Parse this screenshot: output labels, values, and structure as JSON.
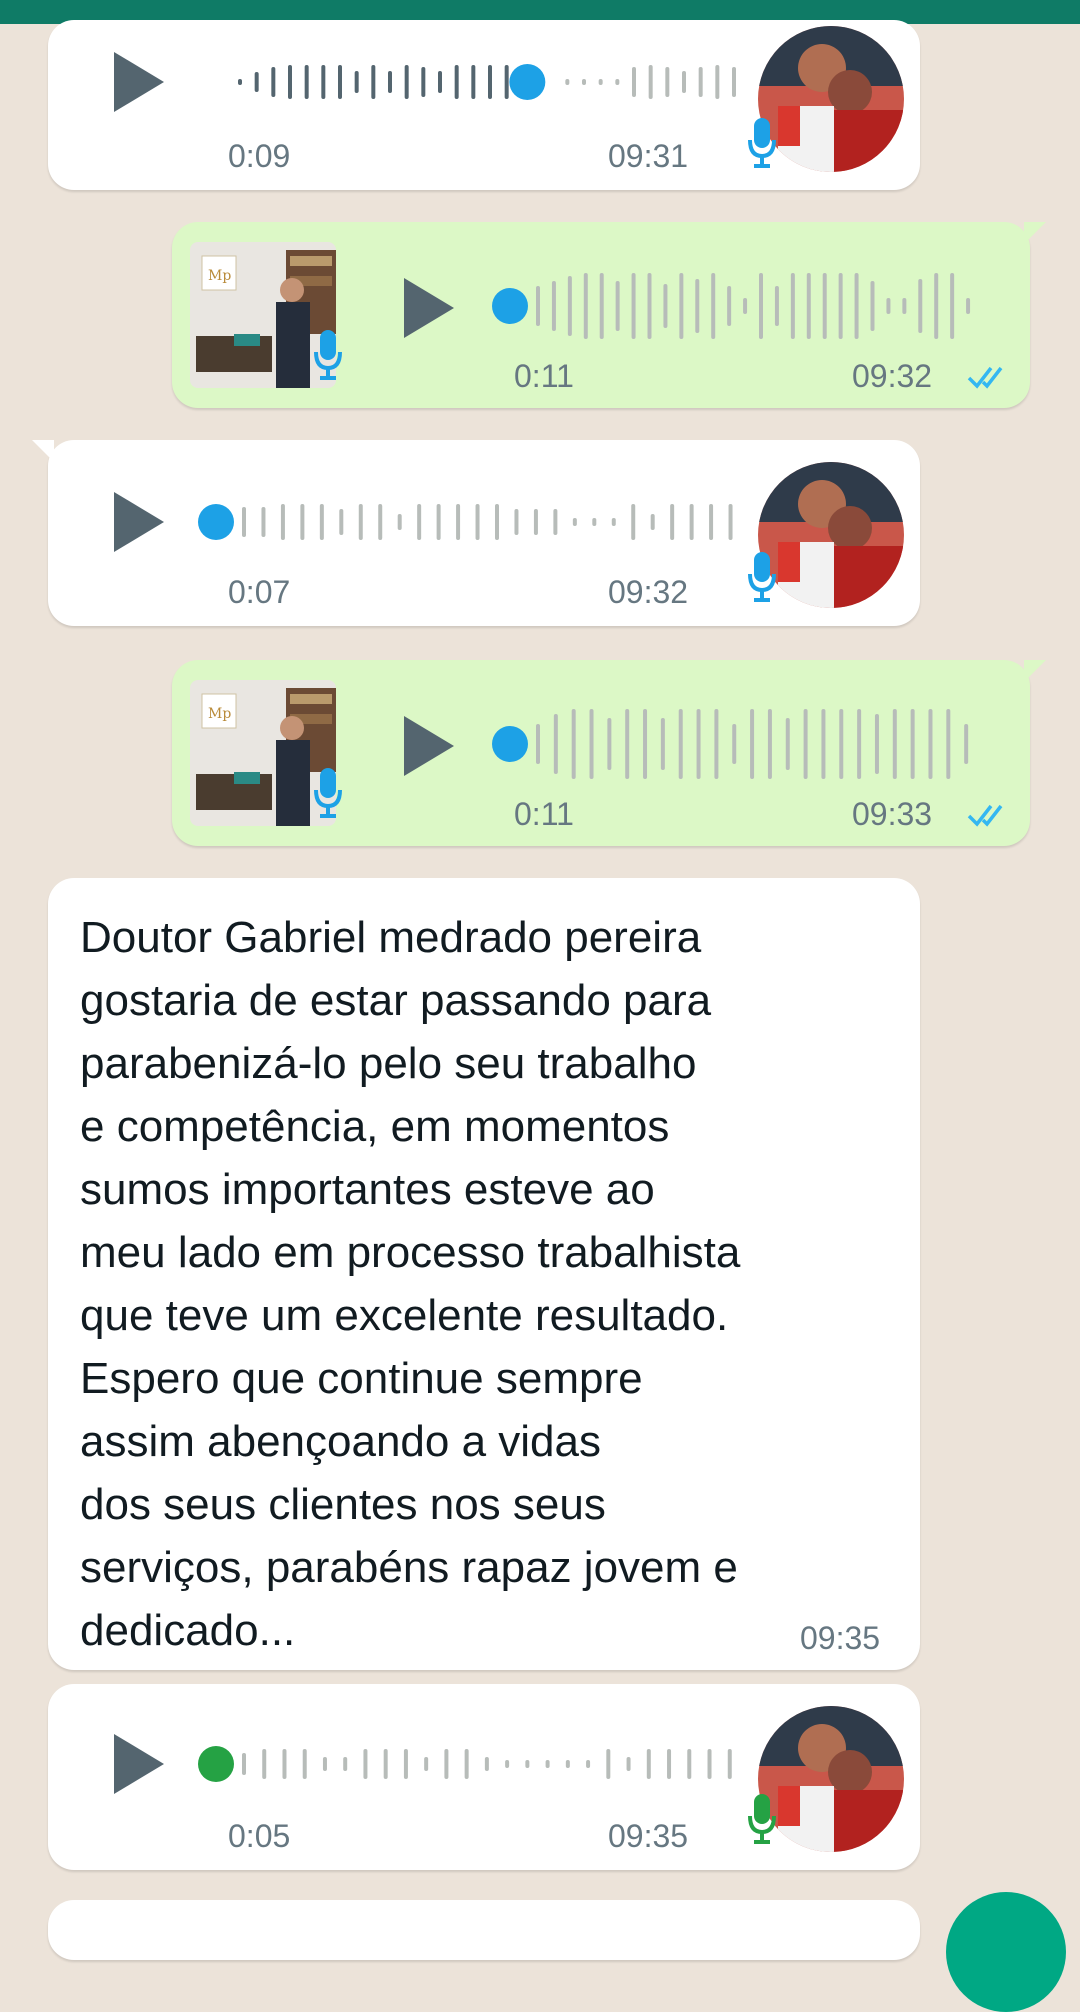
{
  "messages": [
    {
      "kind": "voice",
      "direction": "incoming",
      "duration": "0:09",
      "time": "09:31",
      "mic_color": "#1da1e6"
    },
    {
      "kind": "voice",
      "direction": "outgoing",
      "duration": "0:11",
      "time": "09:32",
      "status": "read"
    },
    {
      "kind": "voice",
      "direction": "incoming",
      "duration": "0:07",
      "time": "09:32",
      "mic_color": "#1da1e6"
    },
    {
      "kind": "voice",
      "direction": "outgoing",
      "duration": "0:11",
      "time": "09:33",
      "status": "read"
    },
    {
      "kind": "text",
      "direction": "incoming",
      "text": "Doutor Gabriel medrado pereira\ngostaria de estar passando para\nparabenizá-lo pelo seu trabalho\ne competência, em momentos\nsumos importantes esteve ao\nmeu lado em processo trabalhista\nque teve um excelente resultado.\nEspero que continue sempre\nassim abençoando a vidas\ndos seus clientes nos seus\nserviços, parabéns rapaz jovem e\ndedicado...",
      "time": "09:35"
    },
    {
      "kind": "voice",
      "direction": "incoming",
      "duration": "0:05",
      "time": "09:35",
      "mic_color": "#25a244"
    }
  ],
  "colors": {
    "header": "#0f7b66",
    "incoming_bubble": "#ffffff",
    "outgoing_bubble": "#dcf8c6",
    "read_ticks": "#34b7f1",
    "played_dot": "#1da1e6",
    "unplayed_dot": "#25a244"
  },
  "icons": [
    "play-icon",
    "microphone-icon",
    "double-check-icon",
    "avatar-photo",
    "profile-thumbnail-photo"
  ]
}
